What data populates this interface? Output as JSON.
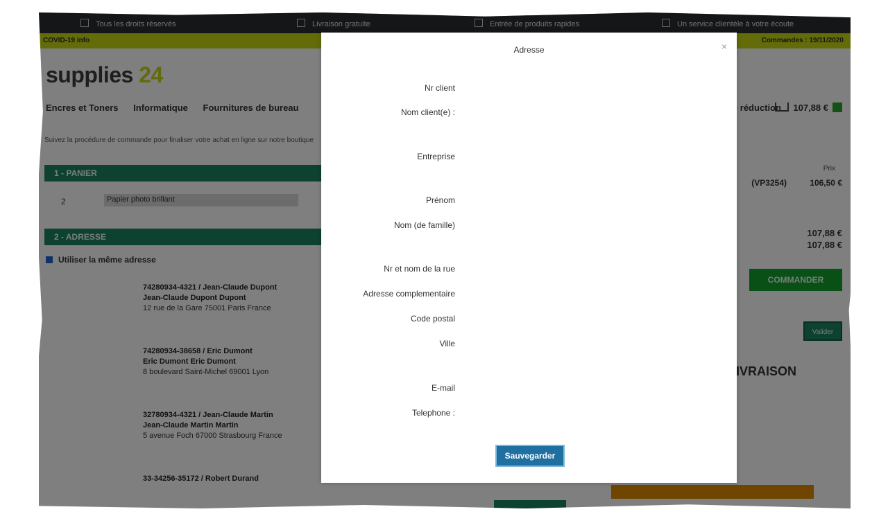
{
  "topbar": {
    "items": [
      "Tous les droits réservés",
      "Livraison gratuite",
      "Entrée de produits rapides",
      "Un service clientèle à votre écoute"
    ]
  },
  "covid_bar": {
    "left": "COVID-19 info",
    "right": "Commandes : 19/11/2020"
  },
  "logo": {
    "text": "supplies",
    "suffix": "24"
  },
  "nav": {
    "items": [
      "Encres et Toners",
      "Informatique",
      "Fournitures de bureau"
    ],
    "vouchers": "Bons de réduction",
    "cart_total": "107,88 €"
  },
  "breadcrumb": "Suivez la procédure de commande pour finaliser votre achat en ligne sur notre boutique",
  "checkout": {
    "step1_label": "1 - PANIER",
    "step1_qty": "2",
    "step1_product": "Papier photo brillant",
    "step2_label": "2 - ADRESSE",
    "same_address_label": "Utiliser la même adresse",
    "addresses": [
      {
        "title": "74280934-4321 / Jean-Claude Dupont",
        "line": "Jean-Claude Dupont Dupont",
        "detail": "12 rue de la Gare 75001 Paris France"
      },
      {
        "title": "74280934-38658 / Eric Dumont",
        "line": "Eric Dumont Eric Dumont",
        "detail": "8 boulevard Saint-Michel 69001 Lyon"
      },
      {
        "title": "32780934-4321 / Jean-Claude Martin",
        "line": "Jean-Claude Martin Martin",
        "detail": "5 avenue Foch 67000 Strasbourg France"
      },
      {
        "title": "33-34256-35172 / Robert Durand",
        "line": "",
        "detail": ""
      }
    ]
  },
  "summary": {
    "head": "Prix",
    "code": "(VP3254)",
    "price": "106,50 €",
    "totals": [
      "107,88 €",
      "107,88 €"
    ],
    "order_button": "COMMANDER",
    "small_button": "Valider",
    "livraison": "LIVRAISON"
  },
  "modal": {
    "title": "Adresse",
    "close": "×",
    "fields": [
      {
        "label": "Nr client"
      },
      {
        "label": "Nom client(e) :"
      },
      {
        "label": "Entreprise"
      },
      {
        "label": "Prénom"
      },
      {
        "label": "Nom (de famille)"
      },
      {
        "label": "Nr et nom de la rue"
      },
      {
        "label": "Adresse complementaire"
      },
      {
        "label": "Code postal"
      },
      {
        "label": "Ville"
      },
      {
        "label": "E-mail"
      },
      {
        "label": "Telephone :"
      }
    ],
    "save_label": "Sauvegarder"
  }
}
